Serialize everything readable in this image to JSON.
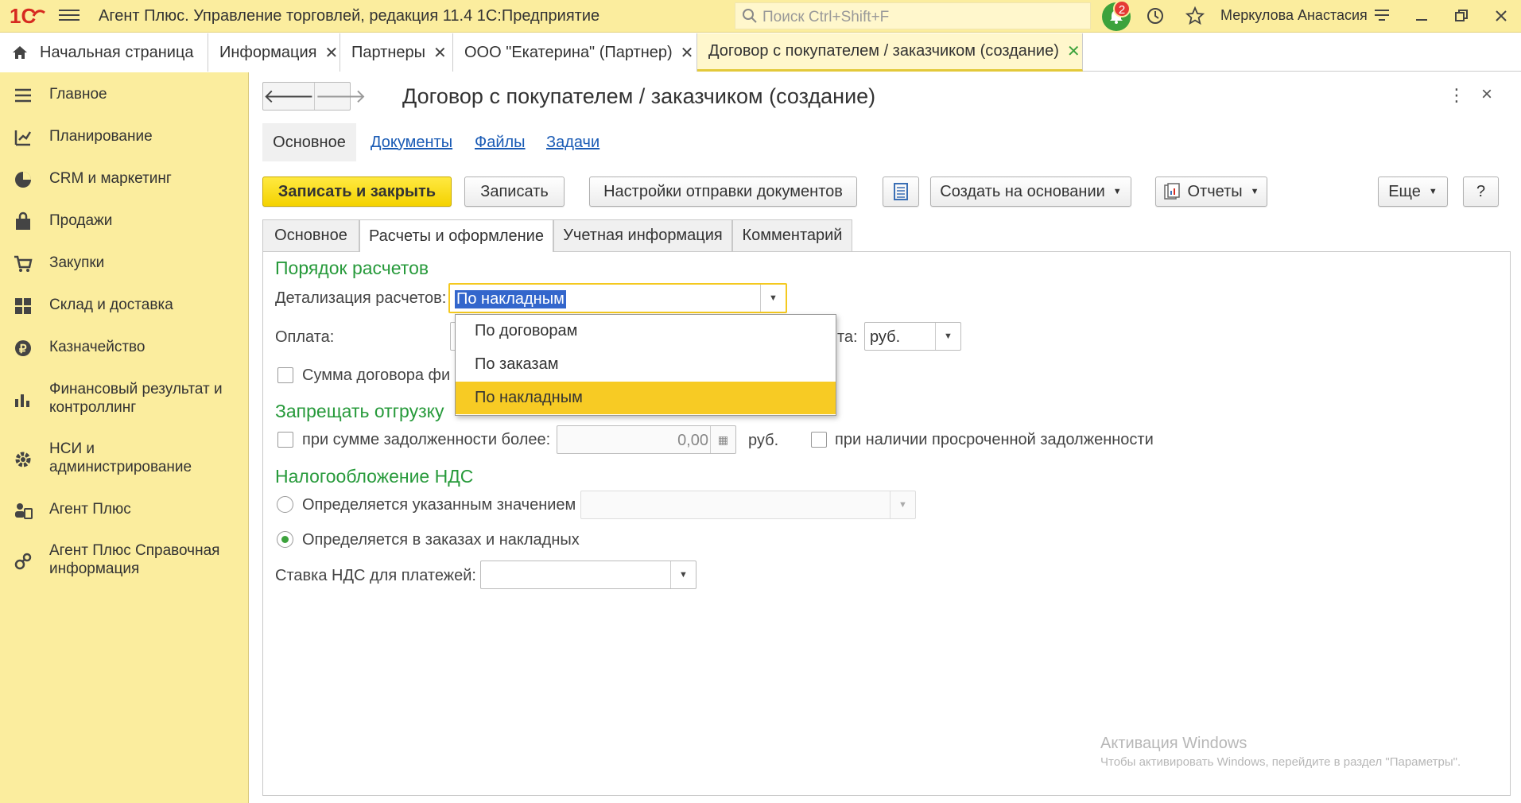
{
  "app": {
    "title": "Агент Плюс. Управление торговлей, редакция 11.4 1С:Предприятие",
    "search_placeholder": "Поиск Ctrl+Shift+F",
    "notifications_count": "2",
    "user": "Меркулова Анастасия"
  },
  "window_tabs": [
    {
      "label": "Начальная страница"
    },
    {
      "label": "Информация"
    },
    {
      "label": "Партнеры"
    },
    {
      "label": "ООО \"Екатерина\" (Партнер)"
    },
    {
      "label": "Договор с покупателем / заказчиком (создание)"
    }
  ],
  "sidebar": {
    "items": [
      {
        "label": "Главное",
        "icon": "menu-lines-icon"
      },
      {
        "label": "Планирование",
        "icon": "planning-icon"
      },
      {
        "label": "CRM и маркетинг",
        "icon": "pie-chart-icon"
      },
      {
        "label": "Продажи",
        "icon": "bag-icon"
      },
      {
        "label": "Закупки",
        "icon": "cart-icon"
      },
      {
        "label": "Склад и доставка",
        "icon": "warehouse-icon"
      },
      {
        "label": "Казначейство",
        "icon": "coin-icon"
      },
      {
        "label": "Финансовый результат и контроллинг",
        "icon": "bar-chart-icon"
      },
      {
        "label": "НСИ и администрирование",
        "icon": "gear-icon"
      },
      {
        "label": "Агент Плюс",
        "icon": "agent-icon"
      },
      {
        "label": "Агент Плюс Справочная информация",
        "icon": "reference-icon"
      }
    ]
  },
  "form": {
    "title": "Договор с покупателем / заказчиком (создание)",
    "nav_panel": {
      "main": "Основное",
      "links": [
        "Документы",
        "Файлы",
        "Задачи"
      ]
    },
    "toolbar": {
      "save_close": "Записать и закрыть",
      "save": "Записать",
      "send_settings": "Настройки отправки документов",
      "create_based": "Создать на основании",
      "reports": "Отчеты",
      "more": "Еще",
      "help": "?"
    },
    "tabs": [
      "Основное",
      "Расчеты и оформление",
      "Учетная информация",
      "Комментарий"
    ],
    "settlement": {
      "section_title": "Порядок расчетов",
      "detail_label": "Детализация расчетов:",
      "detail_value": "По накладным",
      "payment_label": "Оплата:",
      "currency_label_tail": "та:",
      "currency_value": "руб.",
      "sum_fixed_label": "Сумма договора фи"
    },
    "dropdown_options": [
      "По договорам",
      "По заказам",
      "По накладным"
    ],
    "shipment_block": {
      "section_title": "Запрещать отгрузку",
      "debt_over_label": "при сумме задолженности более:",
      "debt_amount": "0,00",
      "debt_currency": "руб.",
      "overdue_label": "при наличии просроченной задолженности"
    },
    "vat": {
      "section_title": "Налогообложение НДС",
      "option_specified": "Определяется указанным значением",
      "option_orders": "Определяется в заказах и накладных",
      "rate_label": "Ставка НДС для платежей:"
    }
  },
  "watermark": {
    "line1": "Активация Windows",
    "line2": "Чтобы активировать Windows, перейдите в раздел \"Параметры\"."
  },
  "colors": {
    "panel_yellow": "#fbed9e",
    "accent_green": "#279a3b",
    "primary_button": "#f4d200",
    "selected_option": "#f7cb24",
    "link_blue": "#1a5bb5"
  }
}
